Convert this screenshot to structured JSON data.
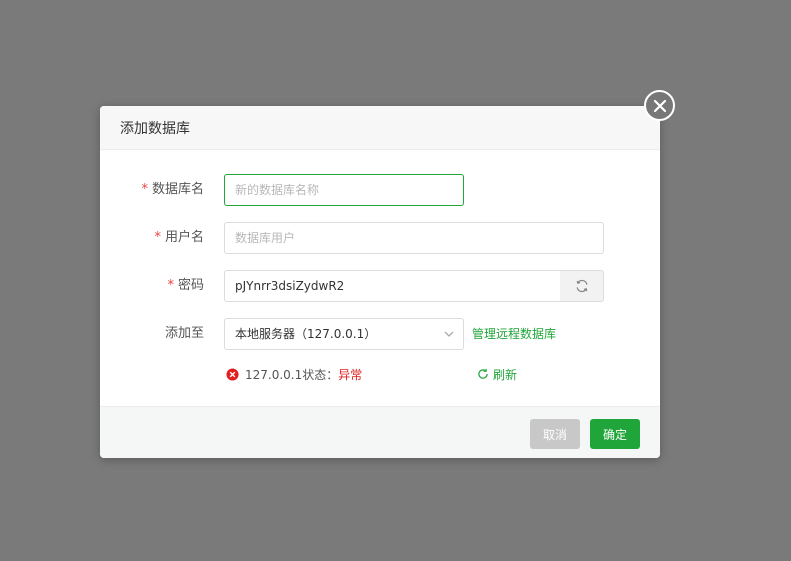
{
  "dialog": {
    "title": "添加数据库"
  },
  "form": {
    "db_name": {
      "label": "数据库名",
      "required": "*",
      "placeholder": "新的数据库名称",
      "value": ""
    },
    "username": {
      "label": "用户名",
      "required": "*",
      "placeholder": "数据库用户",
      "value": ""
    },
    "password": {
      "label": "密码",
      "required": "*",
      "value": "pJYnrr3dsiZydwR2"
    },
    "add_to": {
      "label": "添加至",
      "selected": "本地服务器（127.0.0.1）",
      "manage_link": "管理远程数据库"
    },
    "status": {
      "prefix": "127.0.0.1状态：",
      "state": "异常",
      "refresh_label": "刷新"
    }
  },
  "footer": {
    "cancel_label": "取消",
    "ok_label": "确定"
  },
  "colors": {
    "accent": "#20a53a",
    "error": "#e02020",
    "overlay": "#7a7a7a"
  }
}
